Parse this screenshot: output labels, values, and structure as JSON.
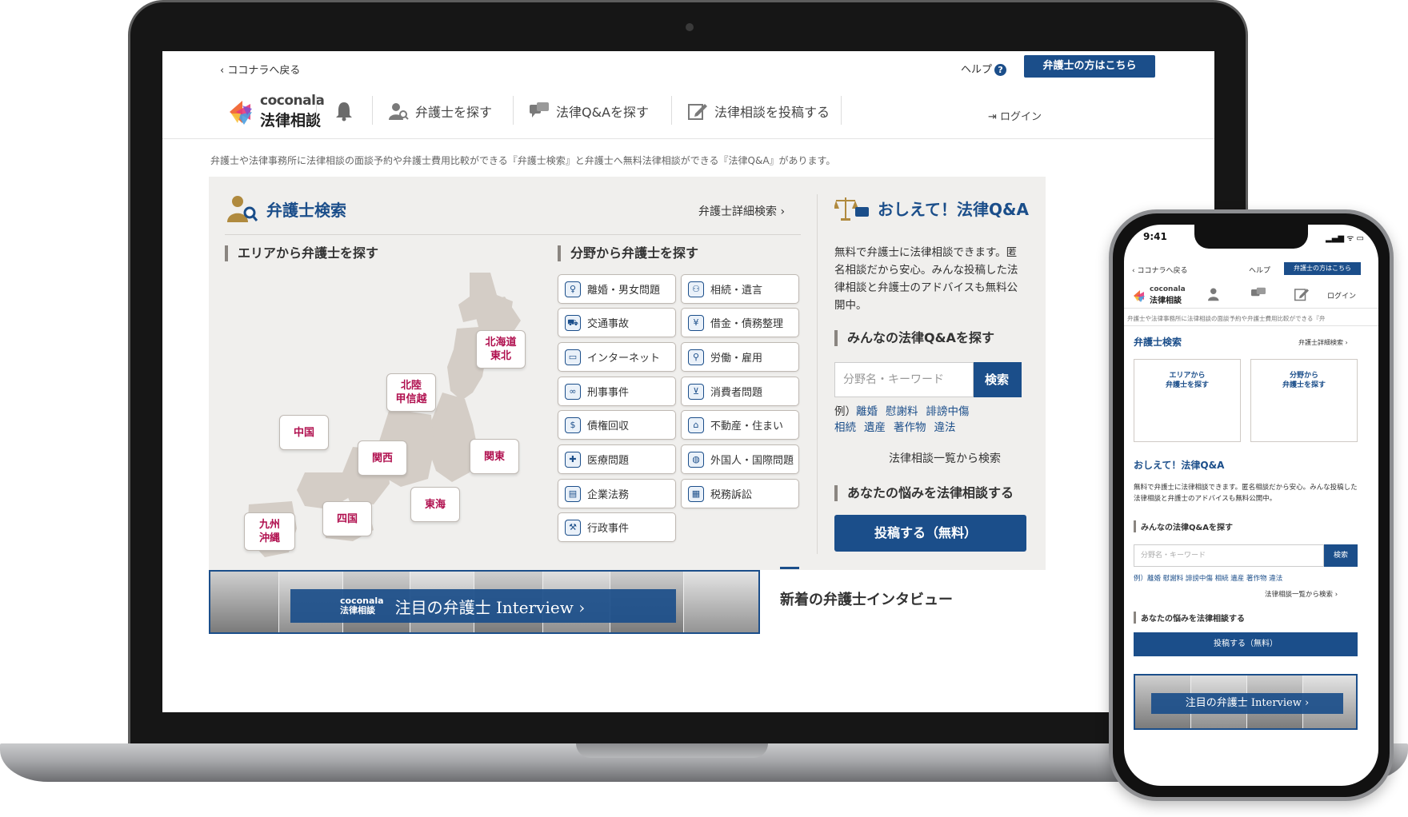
{
  "desktop": {
    "back_link": "‹ ココナラへ戻る",
    "help": "ヘルプ",
    "lawyer_button": "弁護士の方はこちら",
    "logo_en": "coconala",
    "logo_jp": "法律相談",
    "nav": [
      "弁護士を探す",
      "法律Q&Aを探す",
      "法律相談を投稿する"
    ],
    "login": "ログイン",
    "tagline": "弁護士や法律事務所に法律相談の面談予約や弁護士費用比較ができる『弁護士検索』と弁護士へ無料法律相談ができる『法律Q&A』があります。",
    "lawyer_search": {
      "title": "弁護士検索",
      "detail_link": "弁護士詳細検索 ›",
      "area_title": "エリアから弁護士を探す",
      "field_title": "分野から弁護士を探す",
      "regions": [
        {
          "label": "北海道\n東北"
        },
        {
          "label": "北陸\n甲信越"
        },
        {
          "label": "中国"
        },
        {
          "label": "関西"
        },
        {
          "label": "関東"
        },
        {
          "label": "東海"
        },
        {
          "label": "四国"
        },
        {
          "label": "九州\n沖縄"
        }
      ],
      "categories": [
        "離婚・男女問題",
        "相続・遺言",
        "交通事故",
        "借金・債務整理",
        "インターネット",
        "労働・雇用",
        "刑事事件",
        "消費者問題",
        "債権回収",
        "不動産・住まい",
        "医療問題",
        "外国人・国際問題",
        "企業法務",
        "税務訴訟",
        "行政事件"
      ]
    },
    "qa": {
      "title": "おしえて！法律Q&A",
      "description": "無料で弁護士に法律相談できます。匿名相談だから安心。みんな投稿した法律相談と弁護士のアドバイスも無料公開中。",
      "search_title": "みんなの法律Q&Aを探す",
      "placeholder": "分野名・キーワード",
      "search_button": "検索",
      "examples_prefix": "例）",
      "examples": [
        "離婚",
        "慰謝料",
        "誹謗中傷",
        "相続",
        "遺産",
        "著作物",
        "違法"
      ],
      "list_link": "法律相談一覧から検索",
      "post_title": "あなたの悩みを法律相談する",
      "post_button": "投稿する（無料）"
    },
    "banner": {
      "logo_en": "coconala",
      "logo_jp": "法律相談",
      "text": "注目の弁護士 Interview ›"
    },
    "interview_heading": "新着の弁護士インタビュー"
  },
  "mobile": {
    "time": "9:41",
    "status": "▂▄▆ ᯤ ▭",
    "back_link": "‹ ココナラへ戻る",
    "help": "ヘルプ",
    "lawyer_button": "弁護士の方はこちら",
    "logo_en": "coconala",
    "logo_jp": "法律相談",
    "login": "ログイン",
    "tagline": "弁護士や法律事務所に法律相談の面談予約や弁護士費用比較ができる『弁",
    "lawyer_search_title": "弁護士検索",
    "detail_link": "弁護士詳細検索 ›",
    "area_card": "エリアから\n弁護士を探す",
    "field_card": "分野から\n弁護士を探す",
    "qa_title": "おしえて！法律Q&A",
    "qa_desc": "無料で弁護士に法律相談できます。匿名相談だから安心。みんな投稿した法律相談と弁護士のアドバイスも無料公開中。",
    "search_title": "みんなの法律Q&Aを探す",
    "placeholder": "分野名・キーワード",
    "search_button": "検索",
    "examples": "例）離婚 慰謝料 誹謗中傷 相続 遺産 著作物 違法",
    "list_link": "法律相談一覧から検索 ›",
    "post_title": "あなたの悩みを法律相談する",
    "post_button": "投稿する（無料）",
    "banner_text": "注目の弁護士 Interview ›"
  },
  "colors": {
    "brand_blue": "#1b4e8a",
    "region_red": "#b0104f",
    "panel_bg": "#f0efed"
  }
}
